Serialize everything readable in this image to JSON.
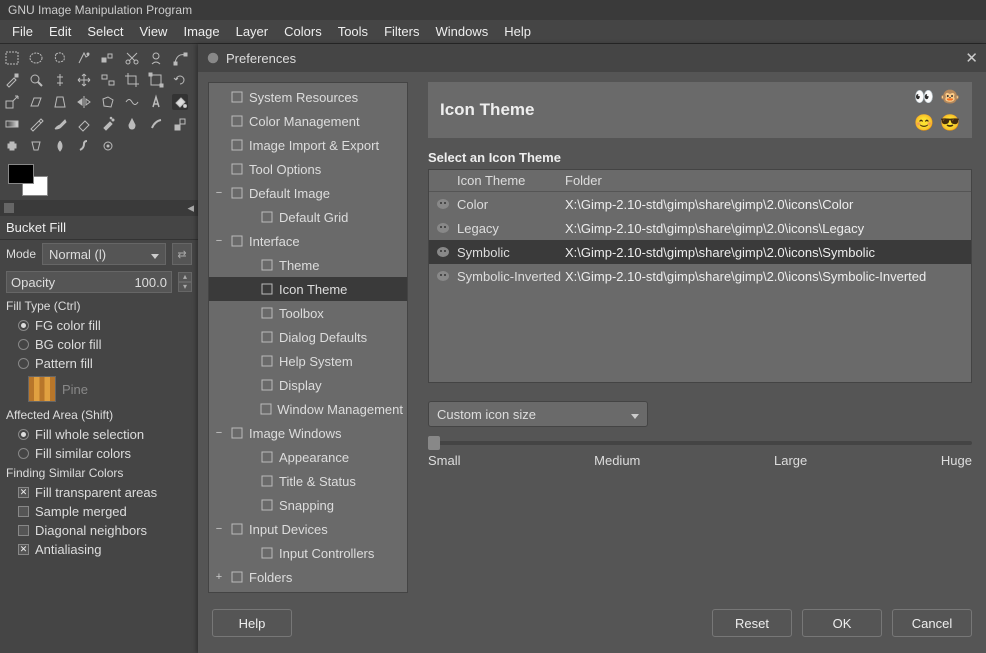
{
  "title": "GNU Image Manipulation Program",
  "menu": [
    "File",
    "Edit",
    "Select",
    "View",
    "Image",
    "Layer",
    "Colors",
    "Tools",
    "Filters",
    "Windows",
    "Help"
  ],
  "tool_options": {
    "title": "Bucket Fill",
    "mode_label": "Mode",
    "mode_value": "Normal (l)",
    "opacity_label": "Opacity",
    "opacity_value": "100.0"
  },
  "fill_type": {
    "label": "Fill Type  (Ctrl)",
    "options": [
      "FG color fill",
      "BG color fill",
      "Pattern fill"
    ],
    "pattern_name": "Pine"
  },
  "affected_area": {
    "label": "Affected Area  (Shift)",
    "options": [
      "Fill whole selection",
      "Fill similar colors"
    ]
  },
  "finding": {
    "label": "Finding Similar Colors",
    "checks": [
      "Fill transparent areas",
      "Sample merged",
      "Diagonal neighbors",
      "Antialiasing"
    ]
  },
  "dialog": {
    "title": "Preferences",
    "tree": [
      {
        "l": "System Resources",
        "d": 0,
        "e": ""
      },
      {
        "l": "Color Management",
        "d": 0,
        "e": ""
      },
      {
        "l": "Image Import & Export",
        "d": 0,
        "e": ""
      },
      {
        "l": "Tool Options",
        "d": 0,
        "e": ""
      },
      {
        "l": "Default Image",
        "d": 0,
        "e": "−"
      },
      {
        "l": "Default Grid",
        "d": 1,
        "e": ""
      },
      {
        "l": "Interface",
        "d": 0,
        "e": "−"
      },
      {
        "l": "Theme",
        "d": 1,
        "e": ""
      },
      {
        "l": "Icon Theme",
        "d": 1,
        "e": "",
        "sel": true
      },
      {
        "l": "Toolbox",
        "d": 1,
        "e": ""
      },
      {
        "l": "Dialog Defaults",
        "d": 1,
        "e": ""
      },
      {
        "l": "Help System",
        "d": 1,
        "e": ""
      },
      {
        "l": "Display",
        "d": 1,
        "e": ""
      },
      {
        "l": "Window Management",
        "d": 1,
        "e": ""
      },
      {
        "l": "Image Windows",
        "d": 0,
        "e": "−"
      },
      {
        "l": "Appearance",
        "d": 1,
        "e": ""
      },
      {
        "l": "Title & Status",
        "d": 1,
        "e": ""
      },
      {
        "l": "Snapping",
        "d": 1,
        "e": ""
      },
      {
        "l": "Input Devices",
        "d": 0,
        "e": "−"
      },
      {
        "l": "Input Controllers",
        "d": 1,
        "e": ""
      },
      {
        "l": "Folders",
        "d": 0,
        "e": "+"
      }
    ],
    "heading": "Icon Theme",
    "section_label": "Select an Icon Theme",
    "table": {
      "headers": [
        "Icon Theme",
        "Folder"
      ],
      "rows": [
        {
          "name": "Color",
          "folder": "X:\\Gimp-2.10-std\\gimp\\share\\gimp\\2.0\\icons\\Color"
        },
        {
          "name": "Legacy",
          "folder": "X:\\Gimp-2.10-std\\gimp\\share\\gimp\\2.0\\icons\\Legacy"
        },
        {
          "name": "Symbolic",
          "folder": "X:\\Gimp-2.10-std\\gimp\\share\\gimp\\2.0\\icons\\Symbolic",
          "sel": true
        },
        {
          "name": "Symbolic-Inverted",
          "folder": "X:\\Gimp-2.10-std\\gimp\\share\\gimp\\2.0\\icons\\Symbolic-Inverted"
        }
      ]
    },
    "size_dd": "Custom icon size",
    "slider": [
      "Small",
      "Medium",
      "Large",
      "Huge"
    ],
    "buttons": {
      "help": "Help",
      "reset": "Reset",
      "ok": "OK",
      "cancel": "Cancel"
    }
  }
}
